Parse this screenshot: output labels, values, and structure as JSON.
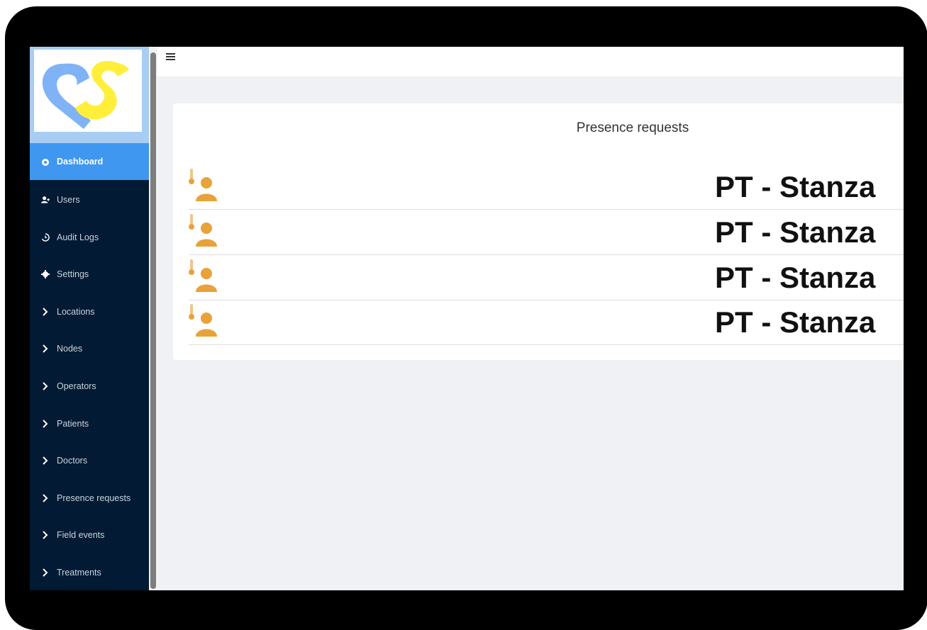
{
  "sidebar": {
    "logo_name": "cs-logo",
    "items": [
      {
        "label": "Dashboard",
        "icon": "dashboard-icon",
        "active": true
      },
      {
        "label": "Users",
        "icon": "user-plus-icon"
      },
      {
        "label": "Audit Logs",
        "icon": "history-icon"
      },
      {
        "label": "Settings",
        "icon": "gear-icon"
      },
      {
        "label": "Locations",
        "icon": "chevron-right-icon"
      },
      {
        "label": "Nodes",
        "icon": "chevron-right-icon"
      },
      {
        "label": "Operators",
        "icon": "chevron-right-icon"
      },
      {
        "label": "Patients",
        "icon": "chevron-right-icon"
      },
      {
        "label": "Doctors",
        "icon": "chevron-right-icon"
      },
      {
        "label": "Presence requests",
        "icon": "chevron-right-icon"
      },
      {
        "label": "Field events",
        "icon": "chevron-right-icon"
      },
      {
        "label": "Treatments",
        "icon": "chevron-right-icon"
      }
    ]
  },
  "topbar": {
    "menu_icon": "hamburger-icon"
  },
  "main": {
    "card_title": "Presence requests",
    "rows": [
      {
        "label": "PT - Stanza",
        "icon": "patient-thermometer-icon"
      },
      {
        "label": "PT - Stanza",
        "icon": "patient-thermometer-icon"
      },
      {
        "label": "PT - Stanza",
        "icon": "patient-thermometer-icon"
      },
      {
        "label": "PT - Stanza",
        "icon": "patient-thermometer-icon"
      }
    ]
  },
  "colors": {
    "sidebar_bg": "#021a33",
    "active_item": "#3f97f0",
    "icon_orange": "#e8a23a",
    "logo_blue": "#7fb3f5",
    "logo_yellow": "#ffef3a"
  }
}
